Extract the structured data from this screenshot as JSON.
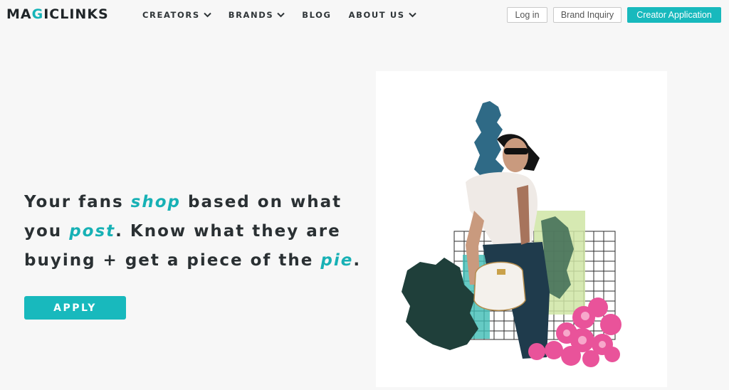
{
  "brand": {
    "logo_prefix": "MA",
    "logo_accent": "G",
    "logo_suffix": "ICLINKS"
  },
  "nav": {
    "items": [
      {
        "label": "CREATORS",
        "has_dropdown": true
      },
      {
        "label": "BRANDS",
        "has_dropdown": true
      },
      {
        "label": "BLOG",
        "has_dropdown": false
      },
      {
        "label": "ABOUT US",
        "has_dropdown": true
      }
    ],
    "login_label": "Log in",
    "brand_inquiry_label": "Brand Inquiry",
    "creator_application_label": "Creator Application"
  },
  "hero": {
    "t1": "Your fans ",
    "t2": "shop",
    "t3": " based on what you ",
    "t4": "post",
    "t5": ". Know what they are buying + get a piece of the ",
    "t6": "pie",
    "t7": ".",
    "apply_label": "APPLY"
  },
  "colors": {
    "accent": "#18b9bd",
    "text": "#2a3033",
    "background": "#f7f7f7"
  }
}
